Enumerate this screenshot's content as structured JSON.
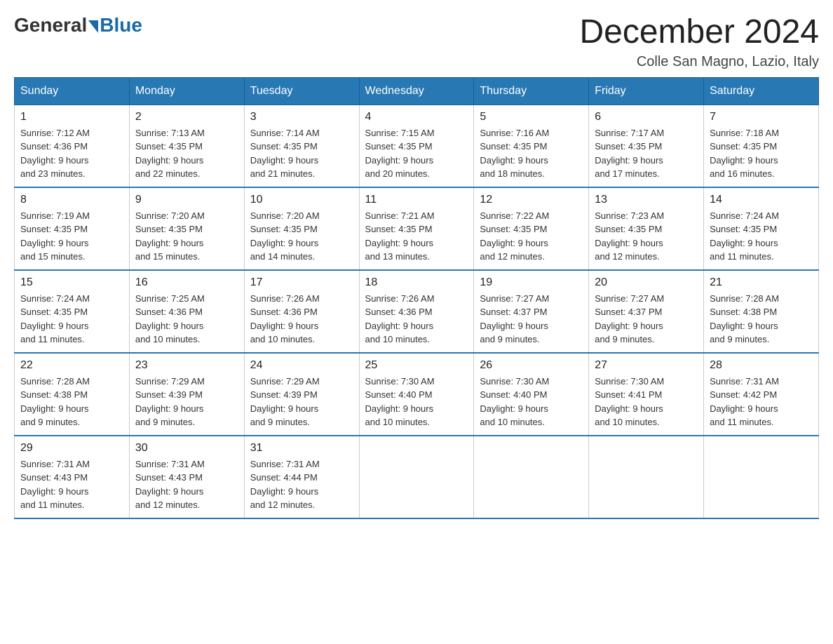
{
  "header": {
    "logo_general": "General",
    "logo_blue": "Blue",
    "month_title": "December 2024",
    "location": "Colle San Magno, Lazio, Italy"
  },
  "days_of_week": [
    "Sunday",
    "Monday",
    "Tuesday",
    "Wednesday",
    "Thursday",
    "Friday",
    "Saturday"
  ],
  "weeks": [
    [
      {
        "day": "1",
        "sunrise": "7:12 AM",
        "sunset": "4:36 PM",
        "daylight": "9 hours and 23 minutes."
      },
      {
        "day": "2",
        "sunrise": "7:13 AM",
        "sunset": "4:35 PM",
        "daylight": "9 hours and 22 minutes."
      },
      {
        "day": "3",
        "sunrise": "7:14 AM",
        "sunset": "4:35 PM",
        "daylight": "9 hours and 21 minutes."
      },
      {
        "day": "4",
        "sunrise": "7:15 AM",
        "sunset": "4:35 PM",
        "daylight": "9 hours and 20 minutes."
      },
      {
        "day": "5",
        "sunrise": "7:16 AM",
        "sunset": "4:35 PM",
        "daylight": "9 hours and 18 minutes."
      },
      {
        "day": "6",
        "sunrise": "7:17 AM",
        "sunset": "4:35 PM",
        "daylight": "9 hours and 17 minutes."
      },
      {
        "day": "7",
        "sunrise": "7:18 AM",
        "sunset": "4:35 PM",
        "daylight": "9 hours and 16 minutes."
      }
    ],
    [
      {
        "day": "8",
        "sunrise": "7:19 AM",
        "sunset": "4:35 PM",
        "daylight": "9 hours and 15 minutes."
      },
      {
        "day": "9",
        "sunrise": "7:20 AM",
        "sunset": "4:35 PM",
        "daylight": "9 hours and 15 minutes."
      },
      {
        "day": "10",
        "sunrise": "7:20 AM",
        "sunset": "4:35 PM",
        "daylight": "9 hours and 14 minutes."
      },
      {
        "day": "11",
        "sunrise": "7:21 AM",
        "sunset": "4:35 PM",
        "daylight": "9 hours and 13 minutes."
      },
      {
        "day": "12",
        "sunrise": "7:22 AM",
        "sunset": "4:35 PM",
        "daylight": "9 hours and 12 minutes."
      },
      {
        "day": "13",
        "sunrise": "7:23 AM",
        "sunset": "4:35 PM",
        "daylight": "9 hours and 12 minutes."
      },
      {
        "day": "14",
        "sunrise": "7:24 AM",
        "sunset": "4:35 PM",
        "daylight": "9 hours and 11 minutes."
      }
    ],
    [
      {
        "day": "15",
        "sunrise": "7:24 AM",
        "sunset": "4:35 PM",
        "daylight": "9 hours and 11 minutes."
      },
      {
        "day": "16",
        "sunrise": "7:25 AM",
        "sunset": "4:36 PM",
        "daylight": "9 hours and 10 minutes."
      },
      {
        "day": "17",
        "sunrise": "7:26 AM",
        "sunset": "4:36 PM",
        "daylight": "9 hours and 10 minutes."
      },
      {
        "day": "18",
        "sunrise": "7:26 AM",
        "sunset": "4:36 PM",
        "daylight": "9 hours and 10 minutes."
      },
      {
        "day": "19",
        "sunrise": "7:27 AM",
        "sunset": "4:37 PM",
        "daylight": "9 hours and 9 minutes."
      },
      {
        "day": "20",
        "sunrise": "7:27 AM",
        "sunset": "4:37 PM",
        "daylight": "9 hours and 9 minutes."
      },
      {
        "day": "21",
        "sunrise": "7:28 AM",
        "sunset": "4:38 PM",
        "daylight": "9 hours and 9 minutes."
      }
    ],
    [
      {
        "day": "22",
        "sunrise": "7:28 AM",
        "sunset": "4:38 PM",
        "daylight": "9 hours and 9 minutes."
      },
      {
        "day": "23",
        "sunrise": "7:29 AM",
        "sunset": "4:39 PM",
        "daylight": "9 hours and 9 minutes."
      },
      {
        "day": "24",
        "sunrise": "7:29 AM",
        "sunset": "4:39 PM",
        "daylight": "9 hours and 9 minutes."
      },
      {
        "day": "25",
        "sunrise": "7:30 AM",
        "sunset": "4:40 PM",
        "daylight": "9 hours and 10 minutes."
      },
      {
        "day": "26",
        "sunrise": "7:30 AM",
        "sunset": "4:40 PM",
        "daylight": "9 hours and 10 minutes."
      },
      {
        "day": "27",
        "sunrise": "7:30 AM",
        "sunset": "4:41 PM",
        "daylight": "9 hours and 10 minutes."
      },
      {
        "day": "28",
        "sunrise": "7:31 AM",
        "sunset": "4:42 PM",
        "daylight": "9 hours and 11 minutes."
      }
    ],
    [
      {
        "day": "29",
        "sunrise": "7:31 AM",
        "sunset": "4:43 PM",
        "daylight": "9 hours and 11 minutes."
      },
      {
        "day": "30",
        "sunrise": "7:31 AM",
        "sunset": "4:43 PM",
        "daylight": "9 hours and 12 minutes."
      },
      {
        "day": "31",
        "sunrise": "7:31 AM",
        "sunset": "4:44 PM",
        "daylight": "9 hours and 12 minutes."
      },
      null,
      null,
      null,
      null
    ]
  ],
  "labels": {
    "sunrise_prefix": "Sunrise: ",
    "sunset_prefix": "Sunset: ",
    "daylight_prefix": "Daylight: "
  }
}
